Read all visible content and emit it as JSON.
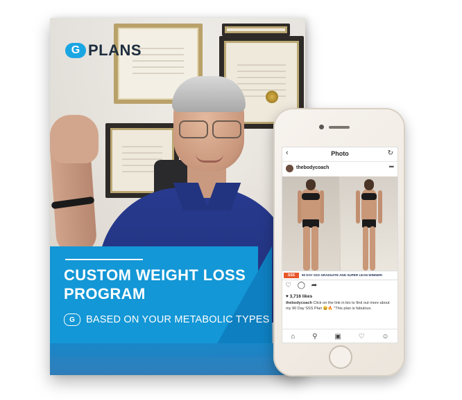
{
  "cover": {
    "logo_mark": "G",
    "logo_text": "PLANS",
    "title_line1": "CUSTOM WEIGHT LOSS",
    "title_line2": "PROGRAM",
    "sub_mark": "G",
    "subtitle": "BASED ON YOUR METABOLIC TYPES"
  },
  "phone": {
    "header_title": "Photo",
    "back_icon": "chevron-left-icon",
    "refresh_icon": "refresh-icon",
    "username": "thebodycoach",
    "more": "•••",
    "tag": "SSS",
    "caption": "90 DAY SSS GRADUATE AND SUPER LEAN WINNER!",
    "likes": "3,716 likes",
    "desc_user": "thebodycoach",
    "desc_text": " Click on the link in bio to find out more about my 90 Day SSS Plan 😄🔥 \"This plan is fabulous.",
    "nav_icons": [
      "home-icon",
      "search-icon",
      "camera-icon",
      "heart-icon",
      "profile-icon"
    ]
  },
  "colors": {
    "banner_blue": "#1397d6",
    "logo_blue": "#19a6e3",
    "suit_navy": "#22347f",
    "tag_orange": "#e8572b"
  }
}
